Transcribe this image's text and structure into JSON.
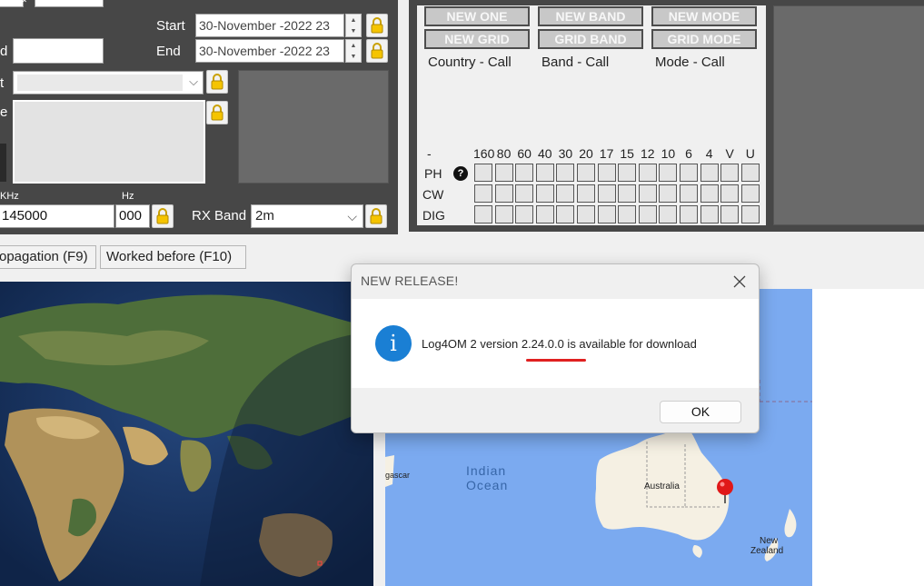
{
  "left_panel": {
    "start_label": "Start",
    "end_label": "End",
    "start_value": "30-November -2022 23",
    "end_value": "30-November -2022 23",
    "partial_label_d": "d",
    "partial_label_t": "t",
    "partial_label_e": "e",
    "khz_label": "KHz",
    "hz_label": "Hz",
    "freq_value": "145000",
    "hz_value": "000",
    "rx_band_label": "RX Band",
    "rx_band_value": "2m"
  },
  "awards": {
    "buttons_row1": [
      "NEW ONE",
      "NEW BAND",
      "NEW MODE"
    ],
    "buttons_row2": [
      "NEW GRID",
      "GRID BAND",
      "GRID MODE"
    ],
    "captions": [
      "Country - Call",
      "Band - Call",
      "Mode - Call"
    ],
    "band_dash": "-",
    "bands": [
      "160",
      "80",
      "60",
      "40",
      "30",
      "20",
      "17",
      "15",
      "12",
      "10",
      "6",
      "4",
      "V",
      "U"
    ],
    "modes": [
      "PH",
      "CW",
      "DIG"
    ]
  },
  "toolbar": {
    "propagation_label": "opagation (F9)",
    "worked_before_label": "Worked before (F10)"
  },
  "map": {
    "indian_ocean_1": "Indian",
    "indian_ocean_2": "Ocean",
    "australia": "Australia",
    "new_zealand_1": "New",
    "new_zealand_2": "Zealand",
    "madagascar_partial": "gascar"
  },
  "dialog": {
    "title": "NEW RELEASE!",
    "message": "Log4OM 2 version 2.24.0.0 is available for download",
    "ok_label": "OK"
  },
  "colors": {
    "panel_dark": "#474747",
    "info_blue": "#1a7fd4",
    "underline_red": "#e02020",
    "map_ocean": "#7baaf0"
  }
}
